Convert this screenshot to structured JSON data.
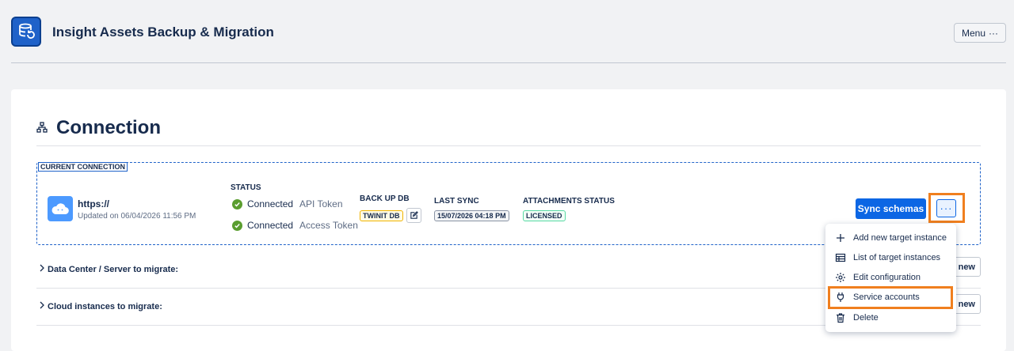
{
  "app": {
    "title": "Insight Assets Backup & Migration",
    "menu_label": "Menu",
    "logo_icon": "database-sync-icon"
  },
  "section": {
    "title": "Connection",
    "icon": "hierarchy-icon"
  },
  "current_connection": {
    "label": "CURRENT CONNECTION",
    "url": "https://",
    "updated": "Updated on 06/04/2026 11:56 PM",
    "status_header": "STATUS",
    "statuses": [
      {
        "value": "Connected",
        "type": "API Token"
      },
      {
        "value": "Connected",
        "type": "Access Token"
      }
    ],
    "backup_db_header": "BACK UP DB",
    "backup_db_value": "TWINIT DB",
    "last_sync_header": "LAST SYNC",
    "last_sync_value": "15/07/2026 04:18 PM",
    "attachments_header": "ATTACHMENTS STATUS",
    "attachments_value": "LICENSED",
    "sync_button": "Sync schemas",
    "more_button": "···"
  },
  "expanders": [
    {
      "label": "Data Center / Server to migrate:",
      "button": "new"
    },
    {
      "label": "Cloud instances to migrate:",
      "button": "new"
    }
  ],
  "dropdown": {
    "items": [
      {
        "label": "Add new target instance",
        "icon": "plus-icon"
      },
      {
        "label": "List of target instances",
        "icon": "table-icon"
      },
      {
        "label": "Edit configuration",
        "icon": "gear-icon"
      },
      {
        "label": "Service accounts",
        "icon": "plug-icon"
      },
      {
        "label": "Delete",
        "icon": "trash-icon"
      }
    ]
  },
  "colors": {
    "primary": "#0c66e4",
    "highlight": "#f07f1e",
    "success": "#5a9d2f"
  }
}
